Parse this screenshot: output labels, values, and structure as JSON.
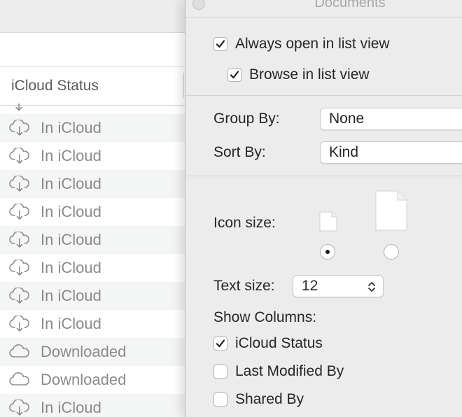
{
  "window": {
    "title": "Documents"
  },
  "finder": {
    "column_header": "iCloud Status",
    "rows": [
      {
        "status": "In iCloud",
        "icon": "cloud-download-icon"
      },
      {
        "status": "In iCloud",
        "icon": "cloud-download-icon"
      },
      {
        "status": "In iCloud",
        "icon": "cloud-download-icon"
      },
      {
        "status": "In iCloud",
        "icon": "cloud-download-icon"
      },
      {
        "status": "In iCloud",
        "icon": "cloud-download-icon"
      },
      {
        "status": "In iCloud",
        "icon": "cloud-download-icon"
      },
      {
        "status": "In iCloud",
        "icon": "cloud-download-icon"
      },
      {
        "status": "In iCloud",
        "icon": "cloud-download-icon"
      },
      {
        "status": "Downloaded",
        "icon": "cloud-icon"
      },
      {
        "status": "Downloaded",
        "icon": "cloud-icon"
      },
      {
        "status": "In iCloud",
        "icon": "cloud-download-icon"
      }
    ]
  },
  "view_options": {
    "always_open_list": {
      "label": "Always open in list view",
      "checked": true
    },
    "browse_list": {
      "label": "Browse in list view",
      "checked": true
    },
    "group_by": {
      "label": "Group By:",
      "value": "None"
    },
    "sort_by": {
      "label": "Sort By:",
      "value": "Kind"
    },
    "icon_size": {
      "label": "Icon size:",
      "selected": "small"
    },
    "text_size": {
      "label": "Text size:",
      "value": "12"
    },
    "show_columns": {
      "label": "Show Columns:",
      "columns": [
        {
          "label": "iCloud Status",
          "checked": true
        },
        {
          "label": "Last Modified By",
          "checked": false
        },
        {
          "label": "Shared By",
          "checked": false
        }
      ]
    }
  },
  "colors": {
    "panel_bg": "#ececec",
    "row_alt": "#f4f5f5",
    "text": "#262626",
    "muted_text": "#8a8a8a"
  }
}
